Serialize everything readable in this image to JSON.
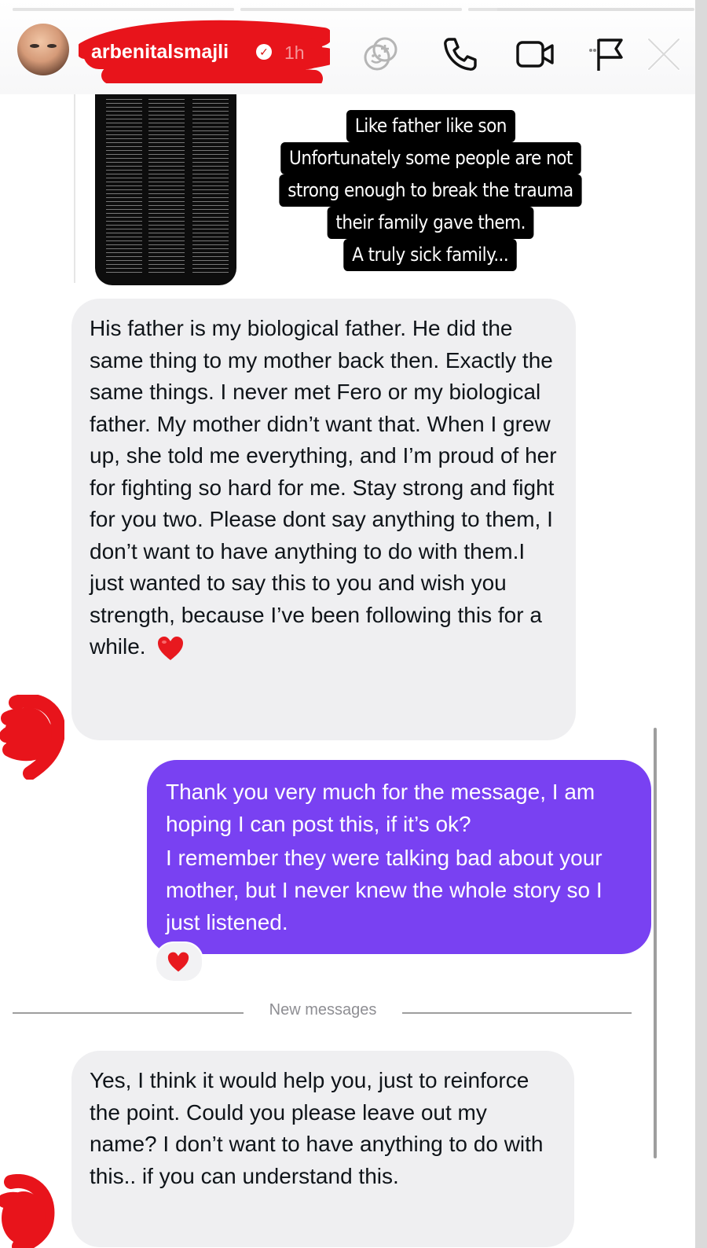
{
  "story": {
    "progress": [
      1.0,
      1.0,
      0.13
    ]
  },
  "header": {
    "username": "arbenitalsmajli",
    "verified_icon": "verified-badge-icon",
    "time": "1h",
    "icons": [
      "effects-icon",
      "phone-icon",
      "video-camera-icon",
      "flag-icon",
      "close-icon"
    ]
  },
  "shared_post": {
    "thumbnail": "document-screenshot",
    "overlay_lines": [
      "Like father like son",
      "Unfortunately some people are not",
      "strong enough to break the trauma",
      "their family gave them.",
      "A truly sick family..."
    ]
  },
  "messages": [
    {
      "direction": "incoming",
      "text": "His father is my biological father. He did the same thing to my mother back then. Exactly the same things. I never met Fero or my biological father. My mother didn’t want that. When I grew up, she told me everything, and I’m proud of her for fighting so hard for me. Stay strong and fight for you two. Please dont say anything to them, I don’t want to have anything to do with them.I just wanted to say this to you and wish you strength, because I’ve been following this for a while.",
      "emoji": "red-heart"
    },
    {
      "direction": "outgoing",
      "text_1": "Thank you very much for the message, I am hoping I can post this, if it’s ok?",
      "text_2": "I remember they were talking bad about your mother, but I never knew the whole story so I just listened.",
      "reaction": "red-heart"
    },
    {
      "direction": "incoming",
      "text": "Yes, I think it would help you, just to reinforce the point. Could you please leave out my name? I don’t want to have anything to do with this.. if you can understand this."
    }
  ],
  "divider": {
    "label": "New messages"
  },
  "colors": {
    "outgoing_bubble": "#7941f2",
    "incoming_bubble": "#efeff1",
    "redaction": "#e8141b",
    "heart": "#e8191f"
  }
}
